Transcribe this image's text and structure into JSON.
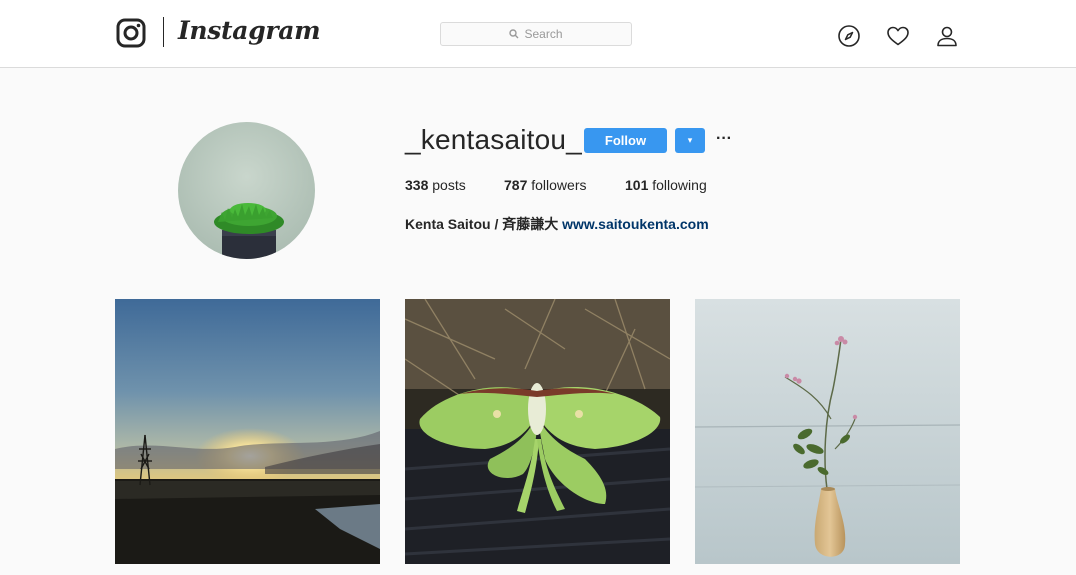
{
  "nav": {
    "brand": "Instagram",
    "search_placeholder": "Search",
    "icons": [
      "instagram-glyph-icon",
      "search-icon",
      "explore-compass-icon",
      "heart-icon",
      "person-icon"
    ]
  },
  "profile": {
    "username": "_kentasaitou_",
    "follow_label": "Follow",
    "dropdown_label": "▾",
    "more_label": "···",
    "stats": {
      "posts_count": "338",
      "posts_label": "posts",
      "followers_count": "787",
      "followers_label": "followers",
      "following_count": "101",
      "following_label": "following"
    },
    "bio_name": "Kenta Saitou / 斉藤謙大",
    "bio_link": "www.saitoukenta.com"
  },
  "posts": [
    {
      "subject": "sunset-over-field"
    },
    {
      "subject": "green-luna-moth"
    },
    {
      "subject": "flower-in-vase"
    }
  ],
  "colors": {
    "accent": "#3897f0",
    "link": "#003569",
    "background": "#fafafa",
    "border": "#dbdbdb"
  }
}
